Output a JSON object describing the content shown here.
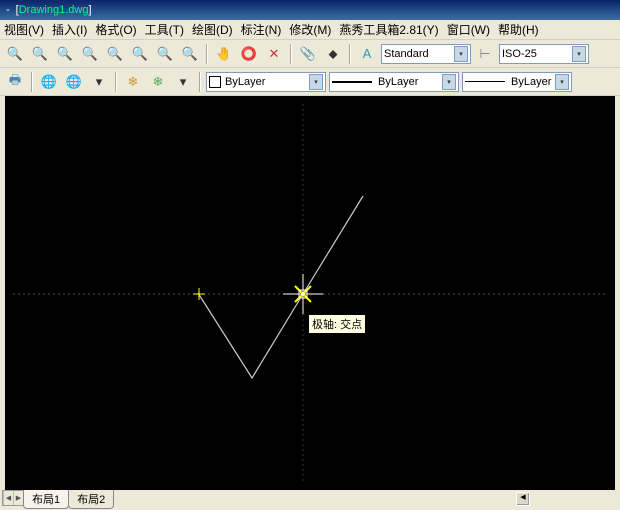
{
  "title": {
    "dash": "-",
    "lb": "[",
    "fname": "Drawing1.dwg",
    "rb": "]"
  },
  "menu": {
    "view": "视图(V)",
    "insert": "插入(I)",
    "format": "格式(O)",
    "tools": "工具(T)",
    "draw": "绘图(D)",
    "dim": "标注(N)",
    "modify": "修改(M)",
    "plugin": "燕秀工具箱2.81(Y)",
    "window": "窗口(W)",
    "help": "帮助(H)"
  },
  "toolbar1": {
    "style": "Standard",
    "dimstyle": "ISO-25"
  },
  "toolbar2": {
    "color": "ByLayer",
    "ltype": "ByLayer",
    "lweight": "ByLayer"
  },
  "osnap_tip": "极轴: 交点",
  "tabs": {
    "layout1": "布局1",
    "layout2": "布局2"
  },
  "icons": {
    "magnify": "🔍",
    "hand": "✋",
    "globe": "🌐",
    "print": "🖶",
    "chevdown": "▾",
    "arrL": "◀",
    "arrR": "▶"
  }
}
